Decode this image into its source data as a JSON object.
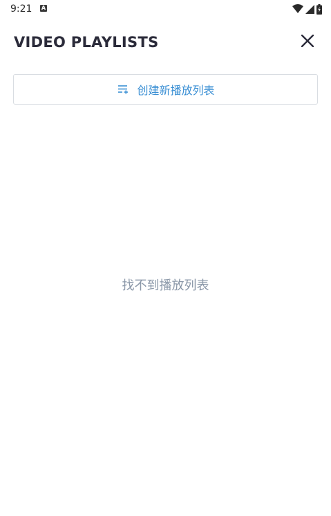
{
  "status_bar": {
    "time": "9:21",
    "notification_icon": "a-notification-icon",
    "wifi_icon": "wifi-icon",
    "signal_icon": "cell-signal-icon",
    "battery_icon": "battery-charging-icon"
  },
  "header": {
    "title": "VIDEO PLAYLISTS",
    "close_icon": "close-icon"
  },
  "create_button": {
    "icon": "playlist-add-icon",
    "label": "创建新播放列表"
  },
  "empty_state": {
    "message": "找不到播放列表"
  },
  "colors": {
    "accent": "#3a8fd4",
    "title": "#2b2b3a",
    "muted": "#8a97a8",
    "border": "#d9dde2"
  }
}
